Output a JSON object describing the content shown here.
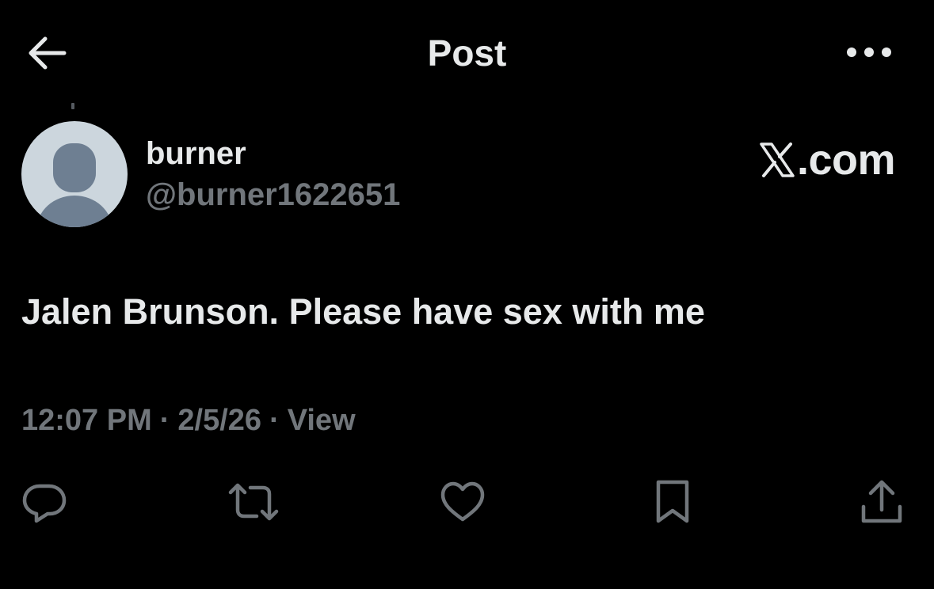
{
  "header": {
    "title": "Post",
    "back_icon": "arrow-left-icon",
    "more_icon": "more-horizontal-icon"
  },
  "author": {
    "display_name": "burner",
    "handle": "@burner1622651",
    "avatar_icon": "default-avatar-icon"
  },
  "brand": {
    "text": ".com",
    "logo_icon": "x-logo-icon"
  },
  "post": {
    "text": "Jalen Brunson. Please have sex with me"
  },
  "meta": {
    "time": "12:07 PM",
    "date": "2/5/26",
    "views_label": "View",
    "separator": "·"
  },
  "actions": {
    "reply_icon": "reply-icon",
    "repost_icon": "repost-icon",
    "like_icon": "like-icon",
    "bookmark_icon": "bookmark-icon",
    "share_icon": "share-icon"
  },
  "colors": {
    "background": "#000000",
    "primary_text": "#e7e9ea",
    "secondary_text": "#71767b",
    "avatar_bg": "#ccd6dd",
    "avatar_figure": "#6e7f92"
  }
}
